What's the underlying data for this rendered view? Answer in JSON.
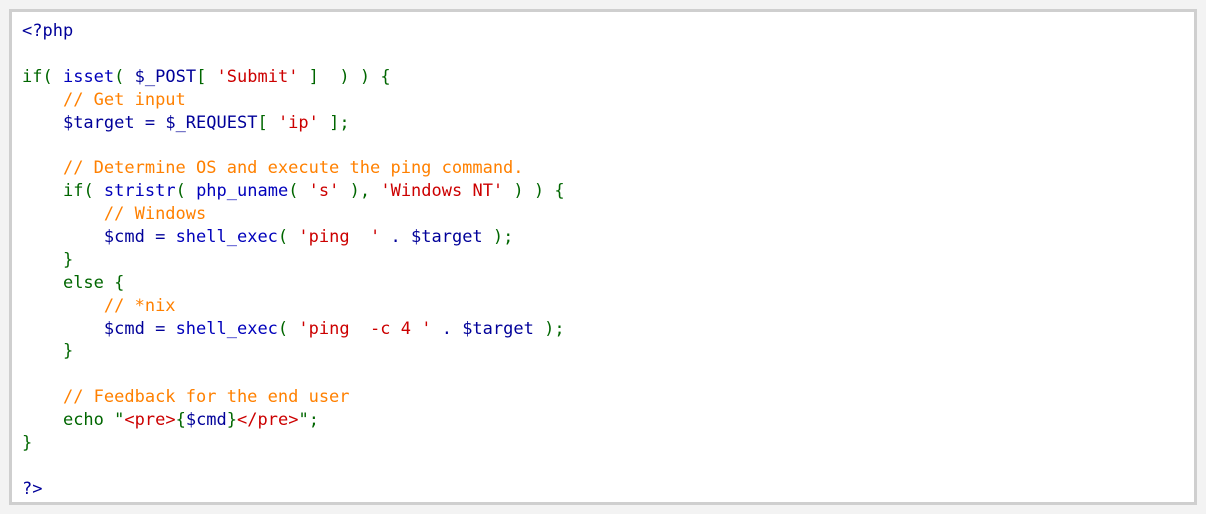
{
  "colors": {
    "keyword": "#006600",
    "function": "#0000bb",
    "variable": "#000099",
    "string": "#cc0000",
    "comment": "#ff8000",
    "tag": "#000099",
    "background": "#ffffff",
    "border": "#cfcfcf"
  },
  "code": {
    "lines": [
      [
        [
          "tag",
          "<?php"
        ]
      ],
      [],
      [
        [
          "keyword",
          "if"
        ],
        [
          "punct",
          "( "
        ],
        [
          "function",
          "isset"
        ],
        [
          "punct",
          "( "
        ],
        [
          "variable",
          "$_POST"
        ],
        [
          "punct",
          "[ "
        ],
        [
          "string",
          "'Submit'"
        ],
        [
          "punct",
          " ]  ) ) {"
        ]
      ],
      [
        [
          "plain",
          "    "
        ],
        [
          "comment",
          "// Get input"
        ]
      ],
      [
        [
          "plain",
          "    "
        ],
        [
          "variable",
          "$target"
        ],
        [
          "variable",
          " = "
        ],
        [
          "variable",
          "$_REQUEST"
        ],
        [
          "punct",
          "[ "
        ],
        [
          "string",
          "'ip'"
        ],
        [
          "punct",
          " ];"
        ]
      ],
      [],
      [
        [
          "plain",
          "    "
        ],
        [
          "comment",
          "// Determine OS and execute the ping command."
        ]
      ],
      [
        [
          "plain",
          "    "
        ],
        [
          "keyword",
          "if"
        ],
        [
          "punct",
          "( "
        ],
        [
          "function",
          "stristr"
        ],
        [
          "punct",
          "( "
        ],
        [
          "function",
          "php_uname"
        ],
        [
          "punct",
          "( "
        ],
        [
          "string",
          "'s'"
        ],
        [
          "punct",
          " ), "
        ],
        [
          "string",
          "'Windows NT'"
        ],
        [
          "punct",
          " ) ) {"
        ]
      ],
      [
        [
          "plain",
          "        "
        ],
        [
          "comment",
          "// Windows"
        ]
      ],
      [
        [
          "plain",
          "        "
        ],
        [
          "variable",
          "$cmd"
        ],
        [
          "variable",
          " = "
        ],
        [
          "function",
          "shell_exec"
        ],
        [
          "punct",
          "( "
        ],
        [
          "string",
          "'ping  '"
        ],
        [
          "variable",
          " . "
        ],
        [
          "variable",
          "$target"
        ],
        [
          "punct",
          " );"
        ]
      ],
      [
        [
          "plain",
          "    "
        ],
        [
          "punct",
          "}"
        ]
      ],
      [
        [
          "plain",
          "    "
        ],
        [
          "keyword",
          "else"
        ],
        [
          "punct",
          " {"
        ]
      ],
      [
        [
          "plain",
          "        "
        ],
        [
          "comment",
          "// *nix"
        ]
      ],
      [
        [
          "plain",
          "        "
        ],
        [
          "variable",
          "$cmd"
        ],
        [
          "variable",
          " = "
        ],
        [
          "function",
          "shell_exec"
        ],
        [
          "punct",
          "( "
        ],
        [
          "string",
          "'ping  -c 4 '"
        ],
        [
          "variable",
          " . "
        ],
        [
          "variable",
          "$target"
        ],
        [
          "punct",
          " );"
        ]
      ],
      [
        [
          "plain",
          "    "
        ],
        [
          "punct",
          "}"
        ]
      ],
      [],
      [
        [
          "plain",
          "    "
        ],
        [
          "comment",
          "// Feedback for the end user"
        ]
      ],
      [
        [
          "plain",
          "    "
        ],
        [
          "keyword",
          "echo"
        ],
        [
          "keyword",
          " \""
        ],
        [
          "string",
          "<pre>"
        ],
        [
          "punct",
          "{"
        ],
        [
          "variable",
          "$cmd"
        ],
        [
          "punct",
          "}"
        ],
        [
          "string",
          "</pre>"
        ],
        [
          "keyword",
          "\";"
        ]
      ],
      [
        [
          "punct",
          "}"
        ]
      ],
      [],
      [
        [
          "tag",
          "?>"
        ]
      ]
    ]
  }
}
